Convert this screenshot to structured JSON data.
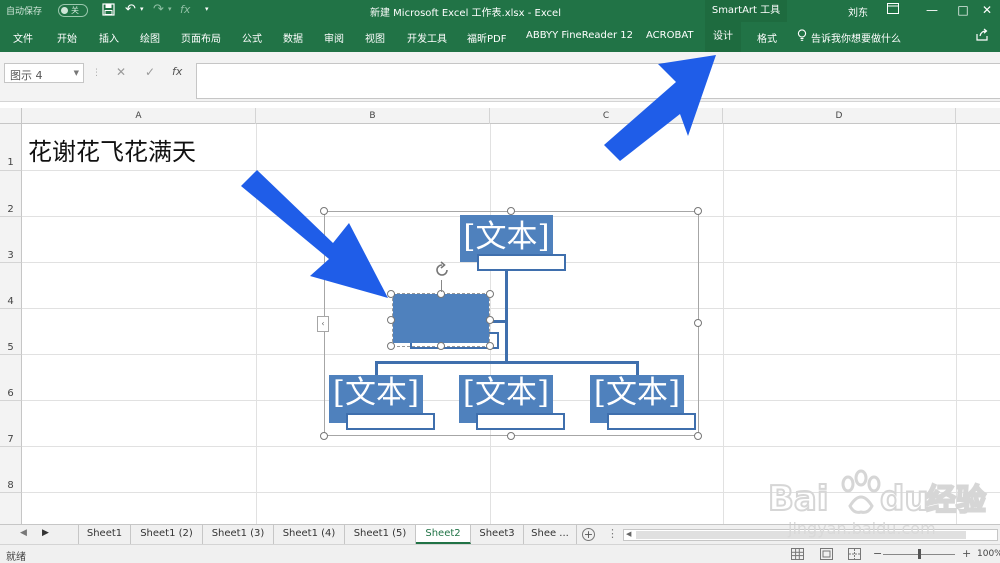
{
  "titlebar": {
    "autosave_label": "自动保存",
    "autosave_state": "关",
    "doc_title": "新建 Microsoft Excel 工作表.xlsx  -  Excel",
    "context_tool": "SmartArt 工具",
    "user": "刘东",
    "minimize": "—",
    "restore": "□",
    "close": "✕"
  },
  "ribbon": {
    "tabs": [
      "文件",
      "开始",
      "插入",
      "绘图",
      "页面布局",
      "公式",
      "数据",
      "审阅",
      "视图",
      "开发工具",
      "福昕PDF",
      "ABBYY FineReader 12",
      "ACROBAT",
      "设计",
      "格式"
    ],
    "selected_tab": "设计",
    "tellme": "告诉我你想要做什么"
  },
  "formula_bar": {
    "name_box": "图示 4",
    "cancel": "✕",
    "enter": "✓",
    "fx": "fx"
  },
  "columns": [
    "A",
    "B",
    "C",
    "D"
  ],
  "rows": [
    "1",
    "2",
    "3",
    "4",
    "5",
    "6",
    "7",
    "8"
  ],
  "cells": {
    "A1": "花谢花飞花满天"
  },
  "smartart": {
    "node_text": "[文本]",
    "collapse": "‹"
  },
  "sheets": [
    "Sheet1",
    "Sheet1 (2)",
    "Sheet1 (3)",
    "Sheet1 (4)",
    "Sheet1 (5)",
    "Sheet2",
    "Sheet3",
    "Shee ..."
  ],
  "active_sheet": "Sheet2",
  "status": {
    "ready": "就绪",
    "zoom": "100%"
  },
  "colors": {
    "excel_green": "#217346",
    "node_blue": "#4f81bd",
    "arrow_blue": "#1f5de8"
  }
}
